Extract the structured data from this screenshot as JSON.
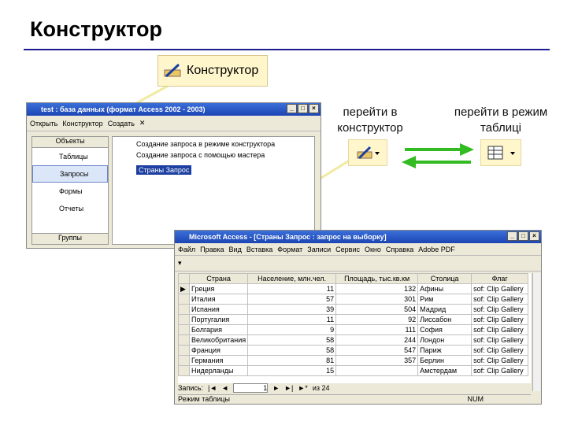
{
  "slide": {
    "title": "Конструктор"
  },
  "callout": {
    "label": "Конструктор"
  },
  "captions": {
    "design": "перейти в конструктор",
    "table": "перейти в режим таблиці"
  },
  "dbwin": {
    "title": "test : база данных (формат Access 2002 - 2003)",
    "toolbar": {
      "open": "Открыть",
      "design": "Конструктор",
      "create": "Создать"
    },
    "objects_header": "Объекты",
    "side": [
      "Таблицы",
      "Запросы",
      "Формы",
      "Отчеты"
    ],
    "groups": "Группы",
    "items": [
      "Создание запроса в режиме конструктора",
      "Создание запроса с помощью мастера",
      "Страны Запрос"
    ]
  },
  "dswin": {
    "title": "Microsoft Access - [Страны Запрос : запрос на выборку]",
    "menu": [
      "Файл",
      "Правка",
      "Вид",
      "Вставка",
      "Формат",
      "Записи",
      "Сервис",
      "Окно",
      "Справка",
      "Adobe PDF"
    ],
    "columns": [
      "Страна",
      "Население, млн.чел.",
      "Площадь, тыс.кв.км",
      "Столица",
      "Флаг"
    ],
    "rows": [
      [
        "Греция",
        "11",
        "132",
        "Афины",
        "sof: Clip Gallery"
      ],
      [
        "Италия",
        "57",
        "301",
        "Рим",
        "sof: Clip Gallery"
      ],
      [
        "Испания",
        "39",
        "504",
        "Мадрид",
        "sof: Clip Gallery"
      ],
      [
        "Португалия",
        "11",
        "92",
        "Лиссабон",
        "sof: Clip Gallery"
      ],
      [
        "Болгария",
        "9",
        "111",
        "София",
        "sof: Clip Gallery"
      ],
      [
        "Великобритания",
        "58",
        "244",
        "Лондон",
        "sof: Clip Gallery"
      ],
      [
        "Франция",
        "58",
        "547",
        "Париж",
        "sof: Clip Gallery"
      ],
      [
        "Германия",
        "81",
        "357",
        "Берлин",
        "sof: Clip Gallery"
      ],
      [
        "Нидерланды",
        "15",
        "",
        "Амстердам",
        "sof: Clip Gallery"
      ]
    ],
    "nav": {
      "label": "Запись:",
      "current": "1",
      "of": "из 24"
    },
    "status": {
      "mode": "Режим таблицы",
      "num": "NUM"
    }
  }
}
